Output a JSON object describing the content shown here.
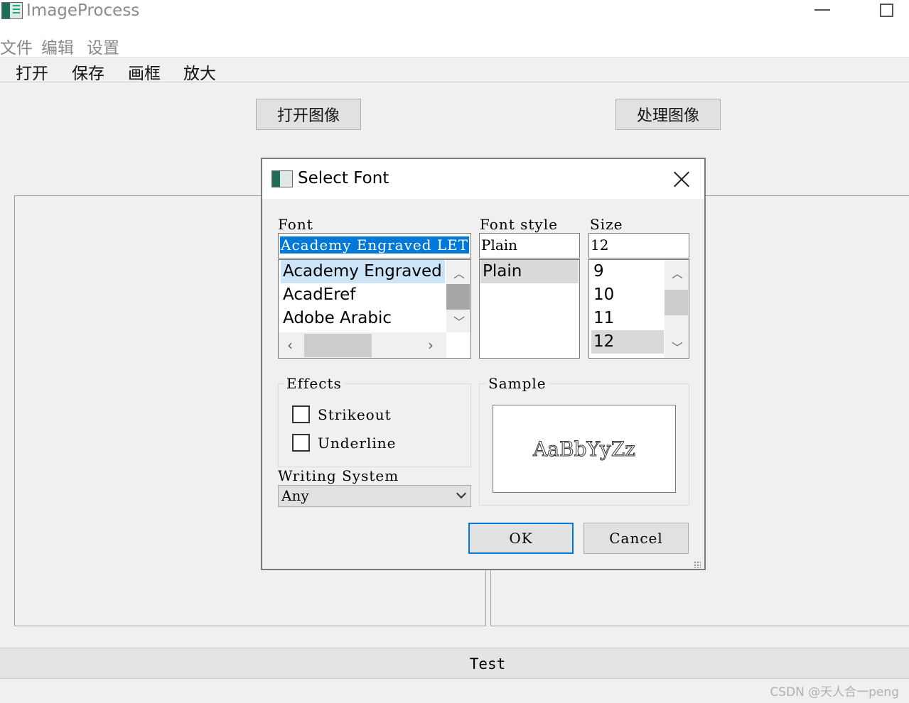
{
  "window": {
    "title": "ImageProcess",
    "menu": [
      "文件",
      "编辑",
      "设置"
    ],
    "toolbar": [
      "打开",
      "保存",
      "画框",
      "放大"
    ],
    "open_button": "打开图像",
    "process_button": "处理图像",
    "status_text": "Test",
    "watermark": "CSDN @天人合一peng"
  },
  "dialog": {
    "title": "Select Font",
    "font_label": "Font",
    "font_value": "Academy Engraved LET",
    "font_list": [
      "Academy Engraved LET",
      "AcadEref",
      "Adobe Arabic"
    ],
    "style_label": "Font style",
    "style_value": "Plain",
    "style_list": [
      "Plain"
    ],
    "size_label": "Size",
    "size_value": "12",
    "size_list": [
      "9",
      "10",
      "11",
      "12"
    ],
    "effects_label": "Effects",
    "strikeout_label": "Strikeout",
    "strikeout_checked": false,
    "underline_label": "Underline",
    "underline_checked": false,
    "writing_system_label": "Writing System",
    "writing_system_value": "Any",
    "sample_label": "Sample",
    "sample_text": "AaBbYyZz",
    "ok_label": "OK",
    "cancel_label": "Cancel"
  },
  "colors": {
    "selection": "#0078d7",
    "current_item": "#cce4f7",
    "background": "#f0f0f0"
  }
}
